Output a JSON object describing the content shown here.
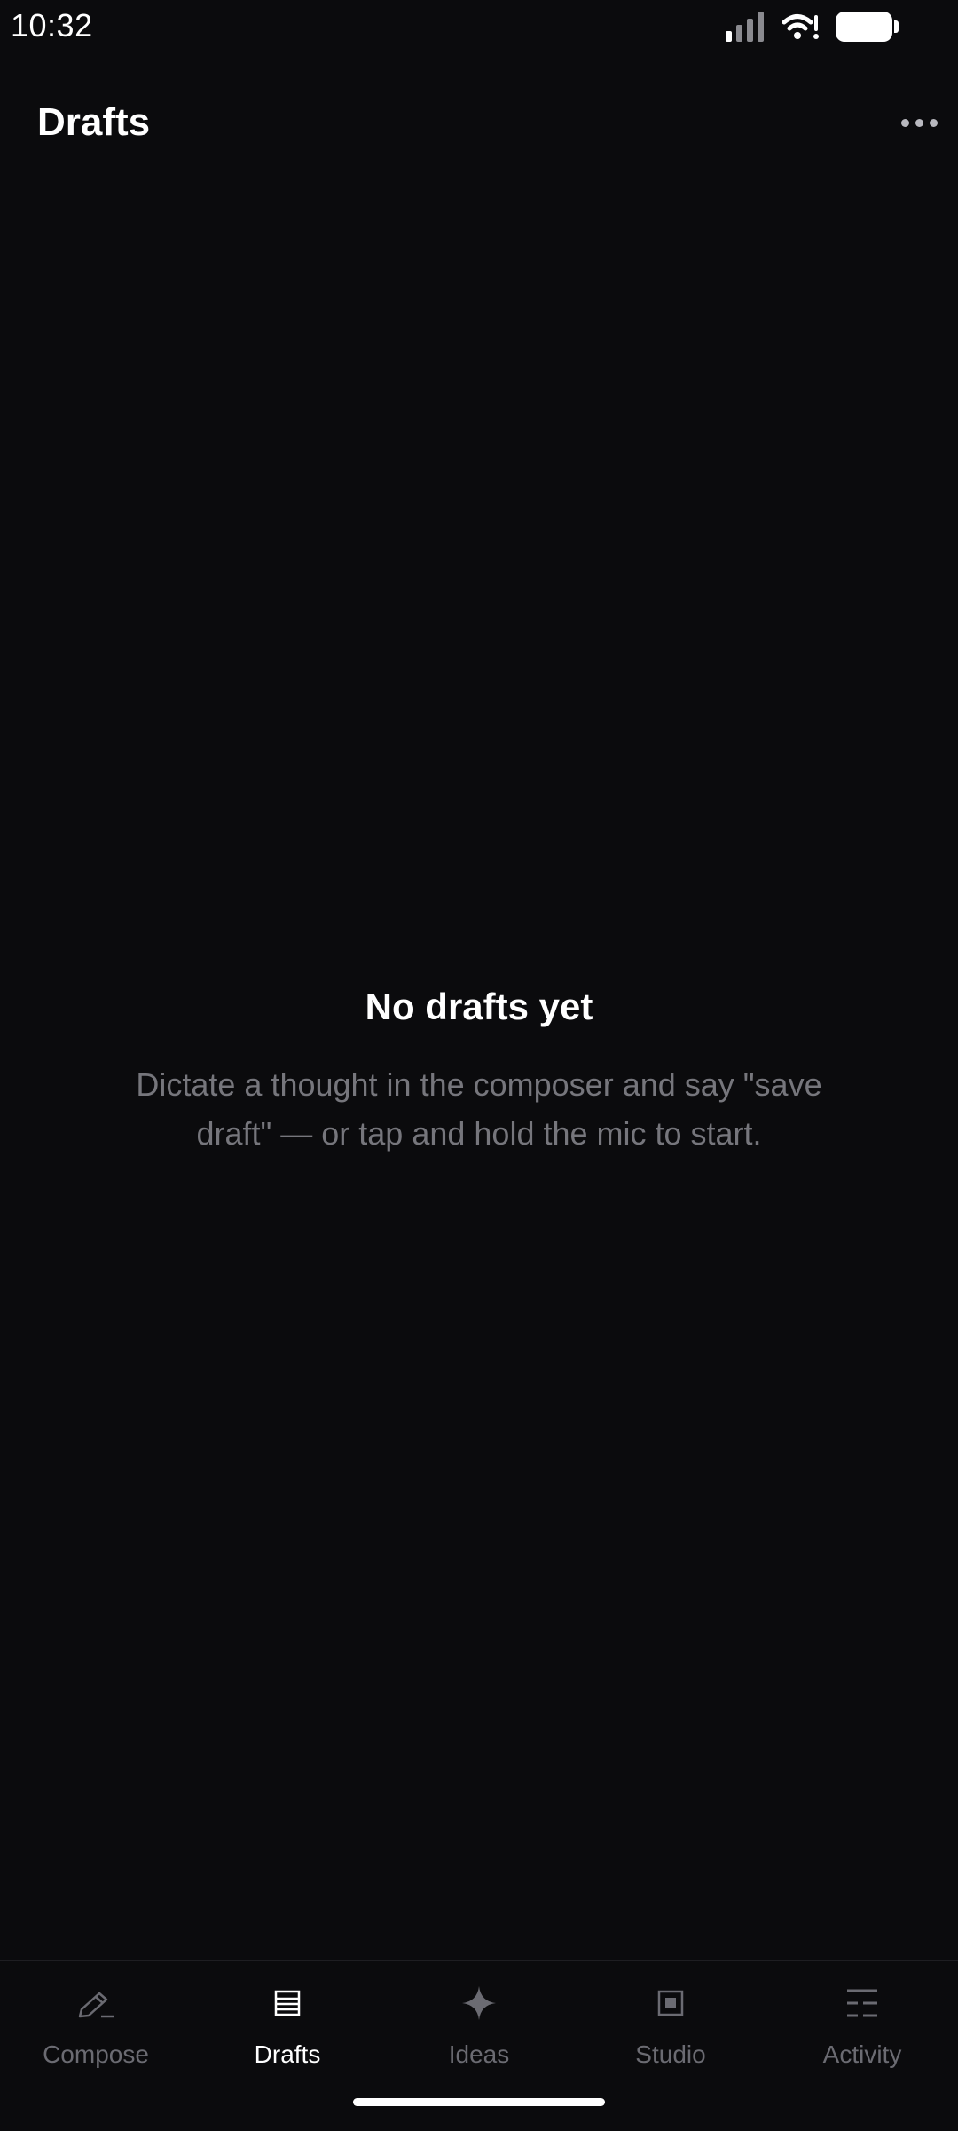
{
  "status_bar": {
    "time": "10:32",
    "icons": [
      "signal-icon",
      "wifi-icon",
      "battery-icon"
    ]
  },
  "header": {
    "title": "Drafts",
    "more_icon": "more-horizontal-icon"
  },
  "empty_state": {
    "title": "No drafts yet",
    "body": "Dictate a thought in the composer and say \"save draft\" — or tap and hold the mic to start."
  },
  "bottom_nav": {
    "active": "Drafts",
    "items": [
      {
        "label": "Compose",
        "icon": "pencil-icon"
      },
      {
        "label": "Drafts",
        "icon": "drafts-list-icon"
      },
      {
        "label": "Ideas",
        "icon": "sparkle-icon"
      },
      {
        "label": "Studio",
        "icon": "studio-square-icon"
      },
      {
        "label": "Activity",
        "icon": "activity-lines-icon"
      }
    ]
  },
  "colors": {
    "background": "#0b0b0d",
    "text_primary": "#ffffff",
    "text_secondary": "#76767c",
    "nav_inactive": "#6b6b72"
  }
}
